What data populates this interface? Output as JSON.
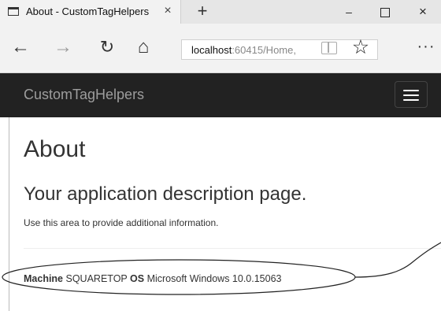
{
  "browser": {
    "tab_title": "About - CustomTagHelpers",
    "tab_close": "×",
    "new_tab": "+",
    "window_minimize": "–",
    "window_close": "×",
    "address_host": "localhost",
    "address_rest": ":60415/Home,",
    "back_glyph": "←",
    "forward_glyph": "→",
    "refresh_glyph": "↻",
    "home_glyph": "⌂",
    "star_glyph": "☆",
    "more_glyph": "···"
  },
  "site": {
    "brand": "CustomTagHelpers",
    "navbar_color": "#222222"
  },
  "page": {
    "heading": "About",
    "subheading": "Your application description page.",
    "info": "Use this area to provide additional information."
  },
  "machine_info": {
    "machine_label": "Machine",
    "machine_value": "SQUARETOP",
    "os_label": "OS",
    "os_value": "Microsoft Windows 10.0.15063"
  },
  "icons": {
    "tab_page": "page-icon",
    "reading_view": "reading-view-icon",
    "favorite": "star-icon",
    "menu": "hamburger-icon",
    "more": "more-icon"
  }
}
